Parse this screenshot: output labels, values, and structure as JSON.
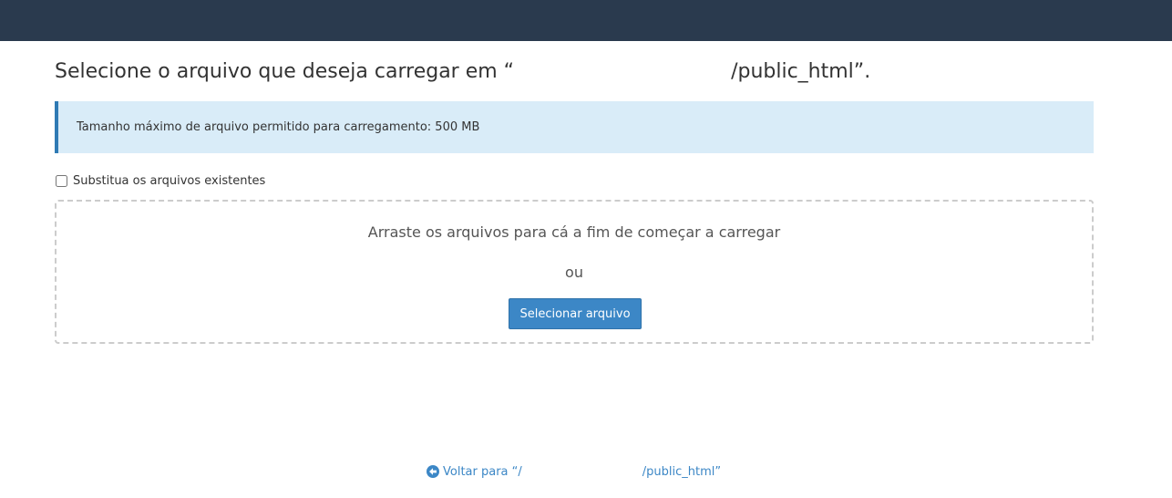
{
  "header": {
    "bar_color": "#2a3a4e"
  },
  "page": {
    "title_prefix": "Selecione o arquivo que deseja carregar em “",
    "title_suffix": "/public_html”."
  },
  "info": {
    "text": "Tamanho máximo de arquivo permitido para carregamento: 500 MB",
    "accent": "#2f7ab4",
    "background": "#d9ecf8"
  },
  "options": {
    "overwrite_label": "Substitua os arquivos existentes",
    "overwrite_checked": false
  },
  "dropzone": {
    "instruction": "Arraste os arquivos para cá a fim de começar a carregar",
    "or_text": "ou",
    "select_button_label": "Selecionar arquivo",
    "button_color": "#3c87c6"
  },
  "footer": {
    "back_prefix": "Voltar para “/",
    "back_suffix": "/public_html”",
    "back_icon": "arrow-circle-left-icon",
    "link_color": "#3c87c6"
  }
}
